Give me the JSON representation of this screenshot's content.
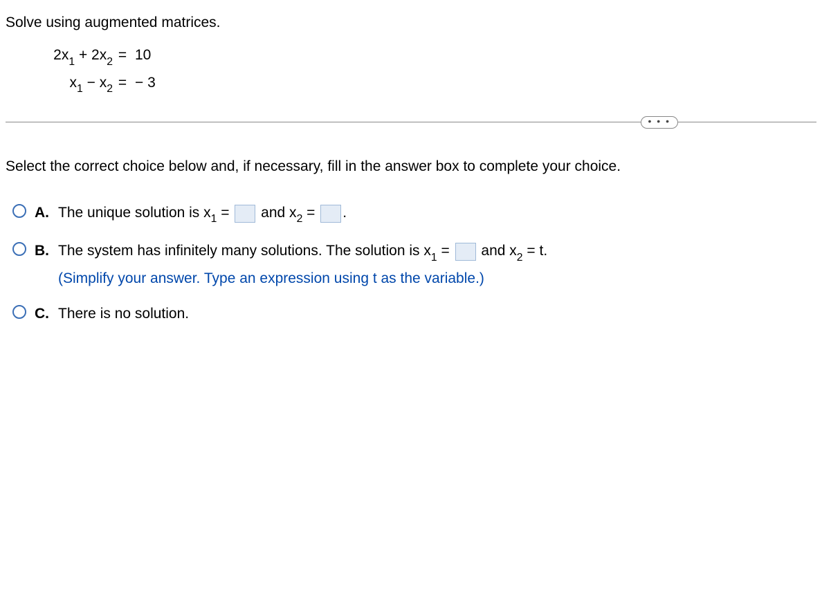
{
  "question": {
    "prompt": "Solve using augmented matrices.",
    "eq1": {
      "lhs_a": "2x",
      "lhs_a_sub": "1",
      "lhs_op": " + ",
      "lhs_b": "2x",
      "lhs_b_sub": "2",
      "rhs": "10"
    },
    "eq2": {
      "lhs_a": "x",
      "lhs_a_sub": "1",
      "lhs_op": " − ",
      "lhs_b": "x",
      "lhs_b_sub": "2",
      "rhs": "− 3"
    }
  },
  "instruction": "Select the correct choice below and, if necessary, fill in the answer box to complete your choice.",
  "choices": {
    "A": {
      "label": "A.",
      "t1": "The unique solution is x",
      "s1": "1",
      "t2": " = ",
      "t3": " and x",
      "s2": "2",
      "t4": " = ",
      "t5": "."
    },
    "B": {
      "label": "B.",
      "t1": "The system has infinitely many solutions. The solution is x",
      "s1": "1",
      "t2": " = ",
      "t3": " and x",
      "s2": "2",
      "t4": " = t.",
      "hint": "(Simplify your answer. Type an expression using t as the variable.)"
    },
    "C": {
      "label": "C.",
      "t1": "There is no solution."
    }
  },
  "dots": "• • •"
}
